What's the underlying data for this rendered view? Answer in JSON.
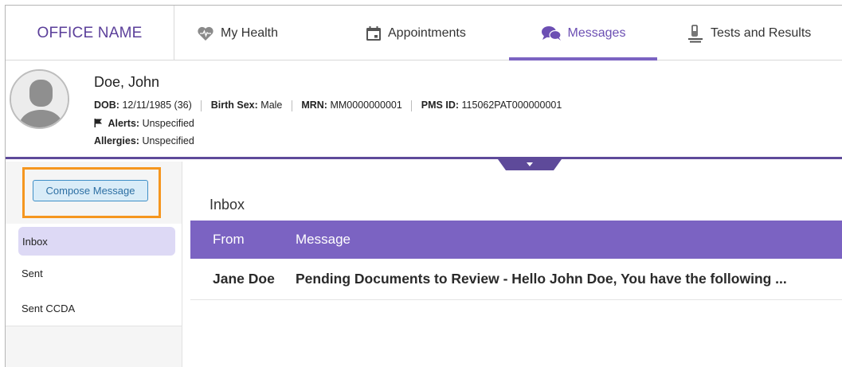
{
  "office": {
    "name": "OFFICE NAME"
  },
  "nav": {
    "tabs": [
      {
        "label": "My Health",
        "icon": "heart-pulse-icon"
      },
      {
        "label": "Appointments",
        "icon": "calendar-icon"
      },
      {
        "label": "Messages",
        "icon": "chat-bubbles-icon",
        "active": true
      },
      {
        "label": "Tests and Results",
        "icon": "microscope-icon"
      }
    ]
  },
  "patient": {
    "name": "Doe, John",
    "dob_label": "DOB:",
    "dob_value": "12/11/1985 (36)",
    "sex_label": "Birth Sex:",
    "sex_value": "Male",
    "mrn_label": "MRN:",
    "mrn_value": "MM0000000001",
    "pms_label": "PMS ID:",
    "pms_value": "115062PAT000000001",
    "alerts_label": "Alerts:",
    "alerts_value": "Unspecified",
    "allergies_label": "Allergies:",
    "allergies_value": "Unspecified"
  },
  "sidebar": {
    "compose_label": "Compose Message",
    "items": [
      {
        "label": "Inbox",
        "active": true
      },
      {
        "label": "Sent"
      },
      {
        "label": "Sent CCDA"
      }
    ]
  },
  "main": {
    "title": "Inbox",
    "columns": [
      "From",
      "Message"
    ],
    "rows": [
      {
        "from": "Jane Doe",
        "message": "Pending Documents to Review - Hello John Doe, You have the following ..."
      }
    ]
  },
  "colors": {
    "accent": "#7b63c2",
    "highlight": "#f5961f",
    "brand_text": "#5b3f9a"
  }
}
